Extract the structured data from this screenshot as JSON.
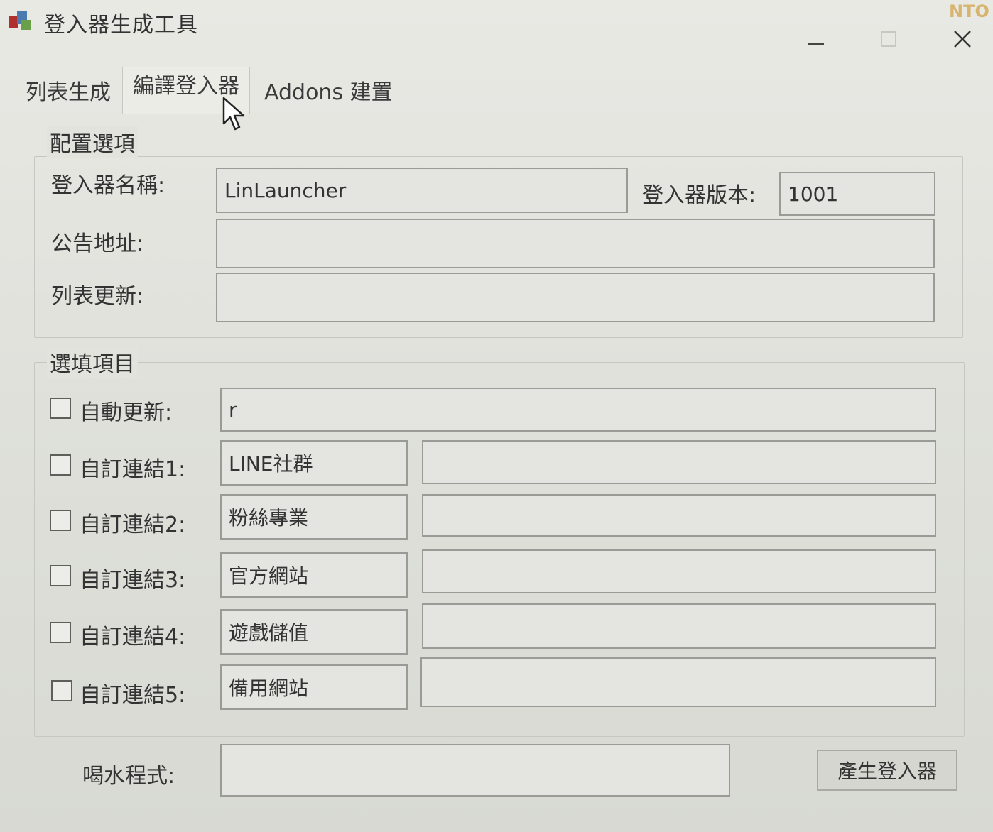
{
  "window": {
    "title": "登入器生成工具",
    "corner_tag": "NTO"
  },
  "tabs": [
    {
      "label": "列表生成"
    },
    {
      "label": "編譯登入器"
    },
    {
      "label": "Addons 建置"
    }
  ],
  "config_group": {
    "title": "配置選項",
    "launcher_name_label": "登入器名稱:",
    "launcher_name_value": "LinLauncher",
    "launcher_version_label": "登入器版本:",
    "launcher_version_value": "1001",
    "notice_url_label": "公告地址:",
    "notice_url_value": "",
    "list_update_label": "列表更新:",
    "list_update_value": ""
  },
  "optional_group": {
    "title": "選填項目",
    "auto_update": {
      "label": "自動更新:",
      "value": "r"
    },
    "custom_links": [
      {
        "label": "自訂連結1:",
        "name": "LINE社群",
        "url": ""
      },
      {
        "label": "自訂連結2:",
        "name": "粉絲專業",
        "url": ""
      },
      {
        "label": "自訂連結3:",
        "name": "官方網站",
        "url": ""
      },
      {
        "label": "自訂連結4:",
        "name": "遊戲儲值",
        "url": ""
      },
      {
        "label": "自訂連結5:",
        "name": "備用網站",
        "url": ""
      }
    ]
  },
  "footer": {
    "drink_program_label": "喝水程式:",
    "drink_program_value": "",
    "generate_button": "產生登入器"
  },
  "colors": {
    "background": "#dfe0da",
    "field_border": "#9a9b96",
    "text": "#333333"
  }
}
